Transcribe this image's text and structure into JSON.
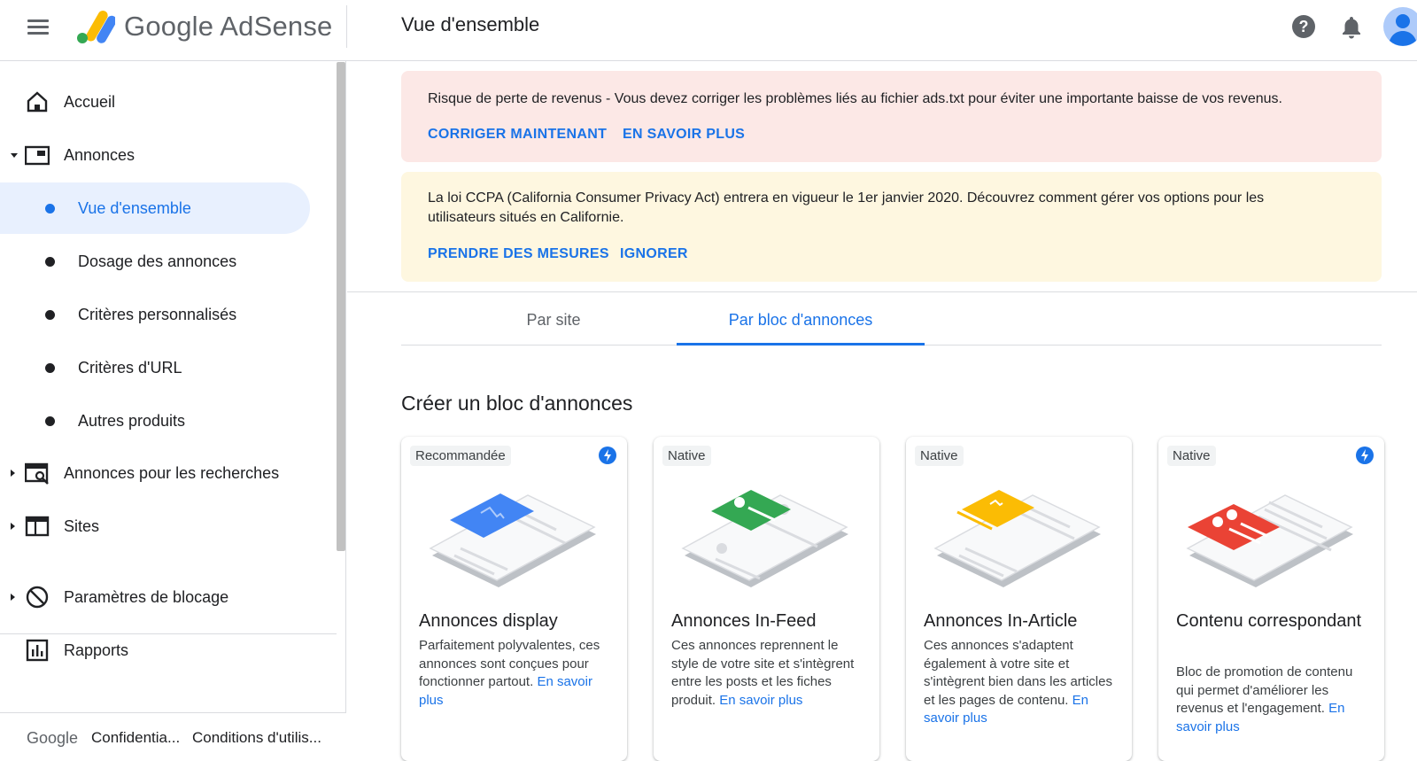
{
  "header": {
    "brand": "Google AdSense",
    "page_title": "Vue d'ensemble"
  },
  "sidebar": {
    "items": [
      {
        "label": "Accueil",
        "icon": "home-icon"
      },
      {
        "label": "Annonces",
        "icon": "ads-icon"
      },
      {
        "label": "Vue d'ensemble",
        "sub": true,
        "active": true
      },
      {
        "label": "Dosage des annonces",
        "sub": true
      },
      {
        "label": "Critères personnalisés",
        "sub": true
      },
      {
        "label": "Critères d'URL",
        "sub": true
      },
      {
        "label": "Autres produits",
        "sub": true
      },
      {
        "label": "Annonces pour les recherches",
        "icon": "search-ads-icon"
      },
      {
        "label": "Sites",
        "icon": "sites-icon"
      },
      {
        "label": "Paramètres de blocage",
        "icon": "block-icon"
      },
      {
        "label": "Rapports",
        "icon": "reports-icon"
      }
    ]
  },
  "footer": {
    "google": "Google",
    "privacy": "Confidentia...",
    "terms": "Conditions d'utilis..."
  },
  "alerts": {
    "revenue": {
      "message": "Risque de perte de revenus - Vous devez corriger les problèmes liés au fichier ads.txt pour éviter une importante baisse de vos revenus.",
      "fix": "CORRIGER MAINTENANT",
      "learn": "EN SAVOIR PLUS"
    },
    "ccpa": {
      "message": "La loi CCPA (California Consumer Privacy Act) entrera en vigueur le 1er janvier 2020. Découvrez comment gérer vos options pour les utilisateurs situés en Californie.",
      "act": "PRENDRE DES MESURES",
      "ignore": "IGNORER"
    }
  },
  "tabs": {
    "by_site": "Par site",
    "by_unit": "Par bloc d'annonces"
  },
  "section_title": "Créer un bloc d'annonces",
  "cards": [
    {
      "badge": "Recommandée",
      "title": "Annonces display",
      "desc": "Parfaitement polyvalentes, ces annonces sont conçues pour fonctionner partout.",
      "link": "En savoir plus",
      "color": "#4285f4"
    },
    {
      "badge": "Native",
      "title": "Annonces In-Feed",
      "desc": "Ces annonces reprennent le style de votre site et s'intègrent entre les posts et les fiches produit.",
      "link": "En savoir plus",
      "color": "#34a853"
    },
    {
      "badge": "Native",
      "title": "Annonces In-Article",
      "desc": "Ces annonces s'adaptent également à votre site et s'intègrent bien dans les articles et les pages de contenu.",
      "link": "En savoir plus",
      "color": "#fbbc04"
    },
    {
      "badge": "Native",
      "title": "Contenu correspondant",
      "desc": "Bloc de promotion de contenu qui permet d'améliorer les revenus et l'engagement.",
      "link": "En savoir plus",
      "color": "#ea4335"
    }
  ]
}
